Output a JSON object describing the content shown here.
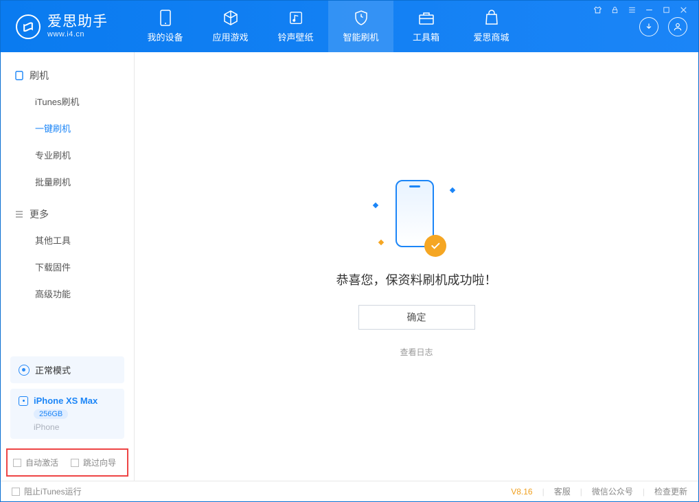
{
  "app": {
    "name": "爱思助手",
    "site": "www.i4.cn"
  },
  "tabs": [
    {
      "label": "我的设备",
      "icon": "device"
    },
    {
      "label": "应用游戏",
      "icon": "cube"
    },
    {
      "label": "铃声壁纸",
      "icon": "music"
    },
    {
      "label": "智能刷机",
      "icon": "shield",
      "active": true
    },
    {
      "label": "工具箱",
      "icon": "toolbox"
    },
    {
      "label": "爱思商城",
      "icon": "bag"
    }
  ],
  "sidebar": {
    "section1": {
      "title": "刷机",
      "items": [
        {
          "label": "iTunes刷机"
        },
        {
          "label": "一键刷机",
          "active": true
        },
        {
          "label": "专业刷机"
        },
        {
          "label": "批量刷机"
        }
      ]
    },
    "section2": {
      "title": "更多",
      "items": [
        {
          "label": "其他工具"
        },
        {
          "label": "下载固件"
        },
        {
          "label": "高级功能"
        }
      ]
    },
    "mode": "正常模式",
    "device": {
      "name": "iPhone XS Max",
      "storage": "256GB",
      "platform": "iPhone"
    },
    "options": {
      "auto_activate": "自动激活",
      "skip_guide": "跳过向导"
    }
  },
  "main": {
    "success_text": "恭喜您，保资料刷机成功啦！",
    "confirm": "确定",
    "view_log": "查看日志"
  },
  "footer": {
    "block_itunes": "阻止iTunes运行",
    "version": "V8.16",
    "links": [
      "客服",
      "微信公众号",
      "检查更新"
    ]
  }
}
